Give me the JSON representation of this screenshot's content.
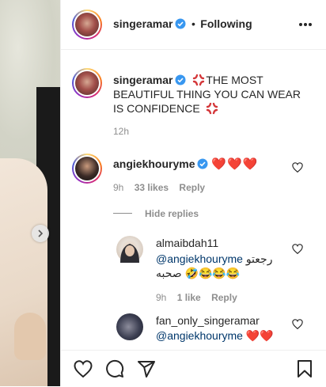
{
  "post": {
    "username": "singeramar",
    "separator": "•",
    "follow_status": "Following",
    "caption": "THE MOST BEAUTIFUL THING YOU CAN WEAR IS CONFIDENCE",
    "time": "12h"
  },
  "comments": [
    {
      "username": "angiekhouryme",
      "text": "❤️❤️❤️",
      "time": "9h",
      "likes": "33 likes",
      "reply": "Reply",
      "hide_replies": "Hide replies",
      "replies": [
        {
          "username": "almaibdah11",
          "mention": "@angiekhouryme",
          "text_arabic": "رجعتو صحبه",
          "emojis": "🤣😂😂😂",
          "time": "9h",
          "likes": "1 like",
          "reply": "Reply"
        },
        {
          "username": "fan_only_singeramar",
          "mention": "@angiekhouryme",
          "text": "❤️❤️"
        }
      ]
    }
  ],
  "icons": {
    "more": "more-horizontal-icon",
    "like": "heart-icon",
    "comment": "comment-icon",
    "share": "paper-plane-icon",
    "save": "bookmark-icon",
    "verified": "verified-badge-icon",
    "next": "chevron-right-icon",
    "caption_emoji": "anger-symbol"
  },
  "colors": {
    "verified": "#3897f0",
    "heart": "#ed4956",
    "link": "#00376b",
    "muted": "#8e8e8e"
  }
}
